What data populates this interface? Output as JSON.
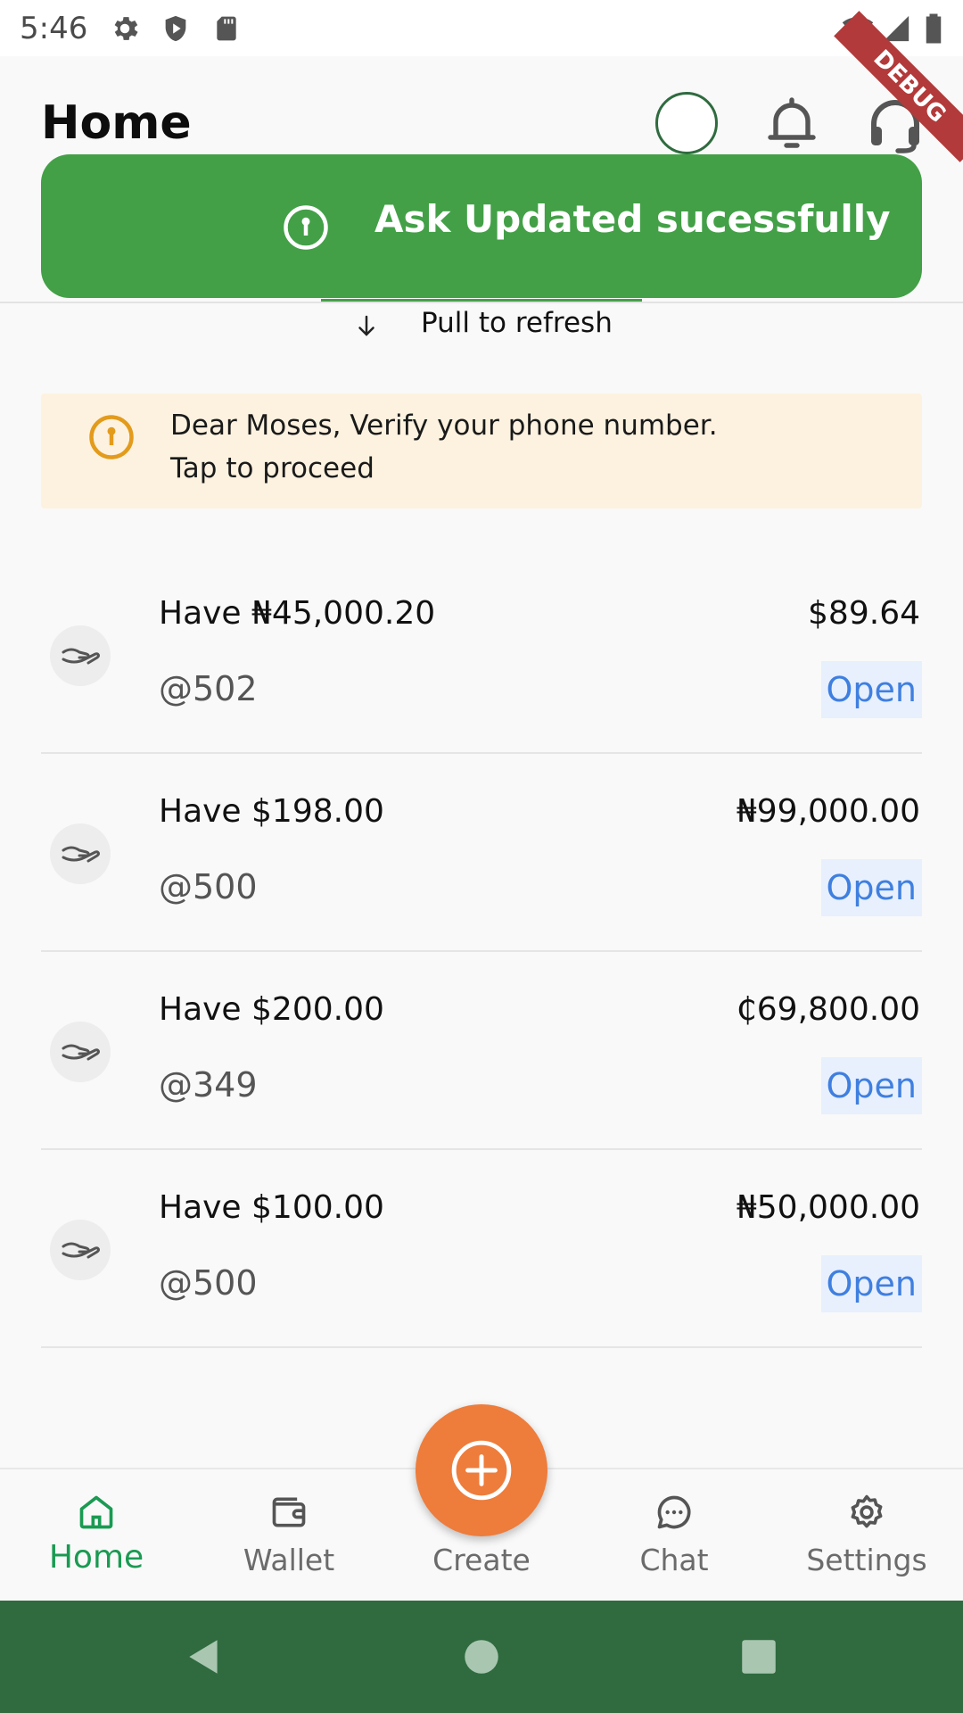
{
  "status_bar": {
    "time": "5:46",
    "icons_left": [
      "gear-icon",
      "shield-play-icon",
      "sd-card-icon"
    ],
    "icons_right": [
      "wifi-icon",
      "signal-icon",
      "battery-icon"
    ]
  },
  "header": {
    "title": "Home",
    "debug_ribbon": "DEBUG"
  },
  "toast": {
    "message": "Ask Updated sucessfully",
    "icon": "info-circle-icon",
    "color": "#43a047"
  },
  "pull_to_refresh": {
    "label": "Pull to refresh"
  },
  "verify_banner": {
    "line1": "Dear Moses, Verify your phone number.",
    "line2": "Tap  to proceed",
    "color": "#fdf2e0",
    "icon_color": "#e39b1c"
  },
  "asks": [
    {
      "have": "Have ₦45,000.20",
      "rate": "@502",
      "amount": "$89.64",
      "status": "Open"
    },
    {
      "have": "Have $198.00",
      "rate": "@500",
      "amount": "₦99,000.00",
      "status": "Open"
    },
    {
      "have": "Have $200.00",
      "rate": "@349",
      "amount": "₵69,800.00",
      "status": "Open"
    },
    {
      "have": "Have $100.00",
      "rate": "@500",
      "amount": "₦50,000.00",
      "status": "Open"
    }
  ],
  "bottom_nav": {
    "items": [
      {
        "label": "Home",
        "icon": "home-icon",
        "active": true
      },
      {
        "label": "Wallet",
        "icon": "wallet-icon",
        "active": false
      },
      {
        "label": "Create",
        "icon": "plus-circle-icon",
        "active": false
      },
      {
        "label": "Chat",
        "icon": "chat-bubble-icon",
        "active": false
      },
      {
        "label": "Settings",
        "icon": "gear-icon",
        "active": false
      }
    ],
    "active_color": "#1a9a52",
    "fab_color": "#ee7c3b"
  },
  "system_nav": {
    "color": "#2f6b3f"
  }
}
